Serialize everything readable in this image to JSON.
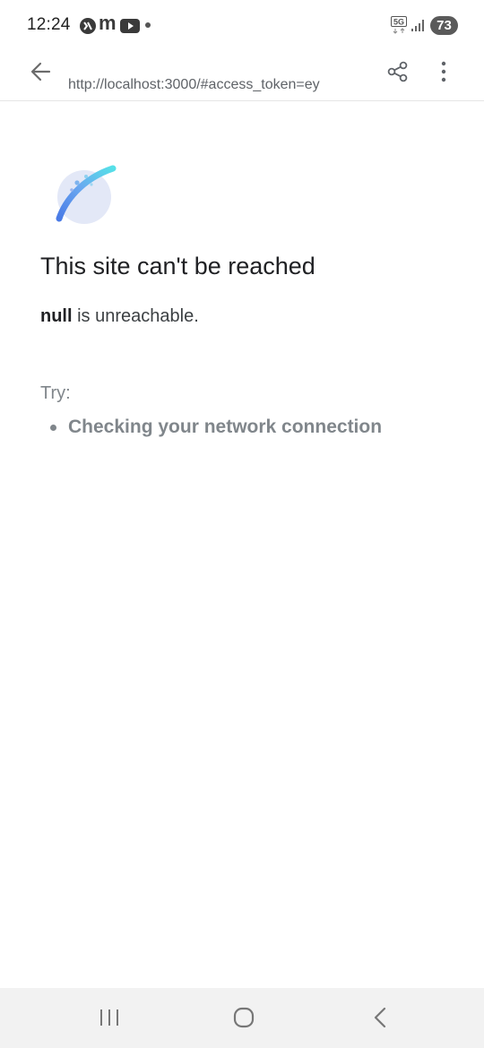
{
  "status_bar": {
    "time": "12:24",
    "notification_icons": [
      "mi-icon",
      "m-icon",
      "youtube-icon",
      "dot-icon"
    ],
    "network_label": "5G",
    "battery_level": "73"
  },
  "top_bar": {
    "url": "http://localhost:3000/#access_token=ey",
    "icons": [
      "back-arrow-icon",
      "share-icon",
      "more-vert-icon"
    ]
  },
  "error_page": {
    "icon": "globe-icon",
    "title": "This site can't be reached",
    "host": "null",
    "detail_suffix": " is unreachable.",
    "try_label": "Try:",
    "suggestions": [
      "Checking your network connection"
    ]
  },
  "nav_bar": {
    "icons": [
      "recents-icon",
      "home-icon",
      "back-icon"
    ]
  },
  "colors": {
    "title_text": "#202124",
    "secondary_text": "#80868b",
    "nav_background": "#f2f2f2",
    "battery_fill": "#5a5a5a"
  }
}
